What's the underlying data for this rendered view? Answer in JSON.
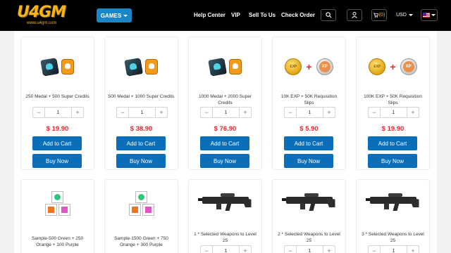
{
  "header": {
    "logo": "U4GM",
    "logo_sub": "www.u4gm.com",
    "games_label": "GAMES",
    "nav": [
      "Help Center",
      "VIP",
      "Sell To Us",
      "Check Order"
    ],
    "cart_count": "(0)",
    "currency": "USD"
  },
  "products": [
    {
      "name": "250 Medal + 500 Super Credits",
      "qty": "1",
      "price": "$ 19.90",
      "add": "Add to Cart",
      "buy": "Buy Now"
    },
    {
      "name": "500 Medal + 1000 Super Credits",
      "qty": "1",
      "price": "$ 38.90",
      "add": "Add to Cart",
      "buy": "Buy Now"
    },
    {
      "name": "1000 Medal + 2000 Super Credits",
      "qty": "1",
      "price": "$ 76.90",
      "add": "Add to Cart",
      "buy": "Buy Now"
    },
    {
      "name": "10K EXP + 50K Requisition Slips",
      "qty": "1",
      "price": "$ 5.90",
      "add": "Add to Cart",
      "buy": "Buy Now",
      "coin_text": "EXP",
      "xp_text": "XP"
    },
    {
      "name": "100K EXP + 50K Requisition Slips",
      "qty": "1",
      "price": "$ 19.90",
      "add": "Add to Cart",
      "buy": "Buy Now",
      "coin_text": "EXP",
      "xp_text": "XP"
    },
    {
      "name": "Sample-500 Green + 250 Orange + 100 Purple"
    },
    {
      "name": "Sample-1500 Green + 750 Orange + 300 Purple"
    },
    {
      "name": "1 * Selected Weapons to Level 25",
      "qty": "1"
    },
    {
      "name": "2 * Selected Weapons to Level 25",
      "qty": "1"
    },
    {
      "name": "3 * Selected Weapons to Level 25",
      "qty": "1"
    }
  ],
  "colors": {
    "accent": "#0a6fb8",
    "price": "#e0262f",
    "logo": "#f2b51a"
  }
}
